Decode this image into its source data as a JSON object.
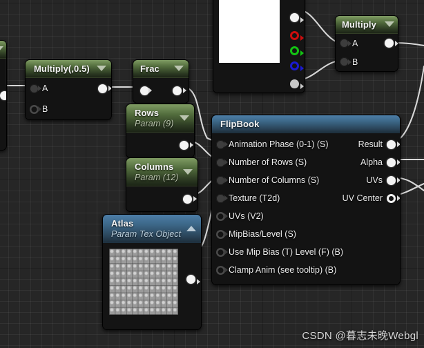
{
  "app": {
    "kind": "material-node-graph",
    "watermark": "CSDN @暮志未晚Webgl"
  },
  "colors": {
    "canvas": "#262626",
    "node_body": "#131313",
    "header_green": "#516b3c",
    "header_blue": "#3c6787",
    "wire": "#d8d8d8",
    "pin_red": "#cc0d0d",
    "pin_green": "#13c413",
    "pin_blue": "#1a1ad2",
    "pin_white": "#f4f4f4"
  },
  "nodes": {
    "multiply_half": {
      "title": "Multiply(,0.5)",
      "inputs": [
        {
          "label": "A",
          "style": "dark"
        },
        {
          "label": "B",
          "style": "hollow"
        }
      ],
      "outputs": [
        {
          "label": "",
          "style": "white"
        }
      ]
    },
    "frac": {
      "title": "Frac",
      "inputs": [
        {
          "label": "",
          "style": "white"
        }
      ],
      "outputs": [
        {
          "label": "",
          "style": "white"
        }
      ]
    },
    "rows": {
      "title": "Rows",
      "subtitle": "Param (9)",
      "outputs": [
        {
          "label": "",
          "style": "white"
        }
      ]
    },
    "columns": {
      "title": "Columns",
      "subtitle": "Param (12)",
      "outputs": [
        {
          "label": "",
          "style": "white"
        }
      ]
    },
    "atlas": {
      "title": "Atlas",
      "subtitle": "Param Tex Object",
      "outputs": [
        {
          "label": "",
          "style": "white"
        }
      ]
    },
    "multiply_top": {
      "title": "Multiply",
      "inputs": [
        {
          "label": "A",
          "style": "dark"
        },
        {
          "label": "B",
          "style": "dark"
        }
      ],
      "outputs": [
        {
          "label": "",
          "style": "white"
        }
      ]
    },
    "texture_sample": {
      "title": "",
      "outputs": [
        {
          "label": "",
          "style": "white"
        },
        {
          "label": "",
          "style": "red"
        },
        {
          "label": "",
          "style": "green"
        },
        {
          "label": "",
          "style": "blue"
        },
        {
          "label": "",
          "style": "grey"
        }
      ]
    },
    "flipbook": {
      "title": "FlipBook",
      "inputs": [
        {
          "label": "Animation  Phase (0-1) (S)",
          "style": "dark"
        },
        {
          "label": "Number of Rows (S)",
          "style": "dark"
        },
        {
          "label": "Number of Columns (S)",
          "style": "dark"
        },
        {
          "label": "Texture (T2d)",
          "style": "dark"
        },
        {
          "label": "UVs (V2)",
          "style": "hollow"
        },
        {
          "label": "MipBias/Level (S)",
          "style": "hollow"
        },
        {
          "label": "Use Mip Bias (T) Level (F) (B)",
          "style": "hollow"
        },
        {
          "label": "Clamp Anim (see tooltip) (B)",
          "style": "hollow"
        }
      ],
      "outputs": [
        {
          "label": "Result",
          "style": "white"
        },
        {
          "label": "Alpha",
          "style": "white"
        },
        {
          "label": "UVs",
          "style": "white"
        },
        {
          "label": "UV Center",
          "style": "whitehollow"
        }
      ]
    }
  }
}
